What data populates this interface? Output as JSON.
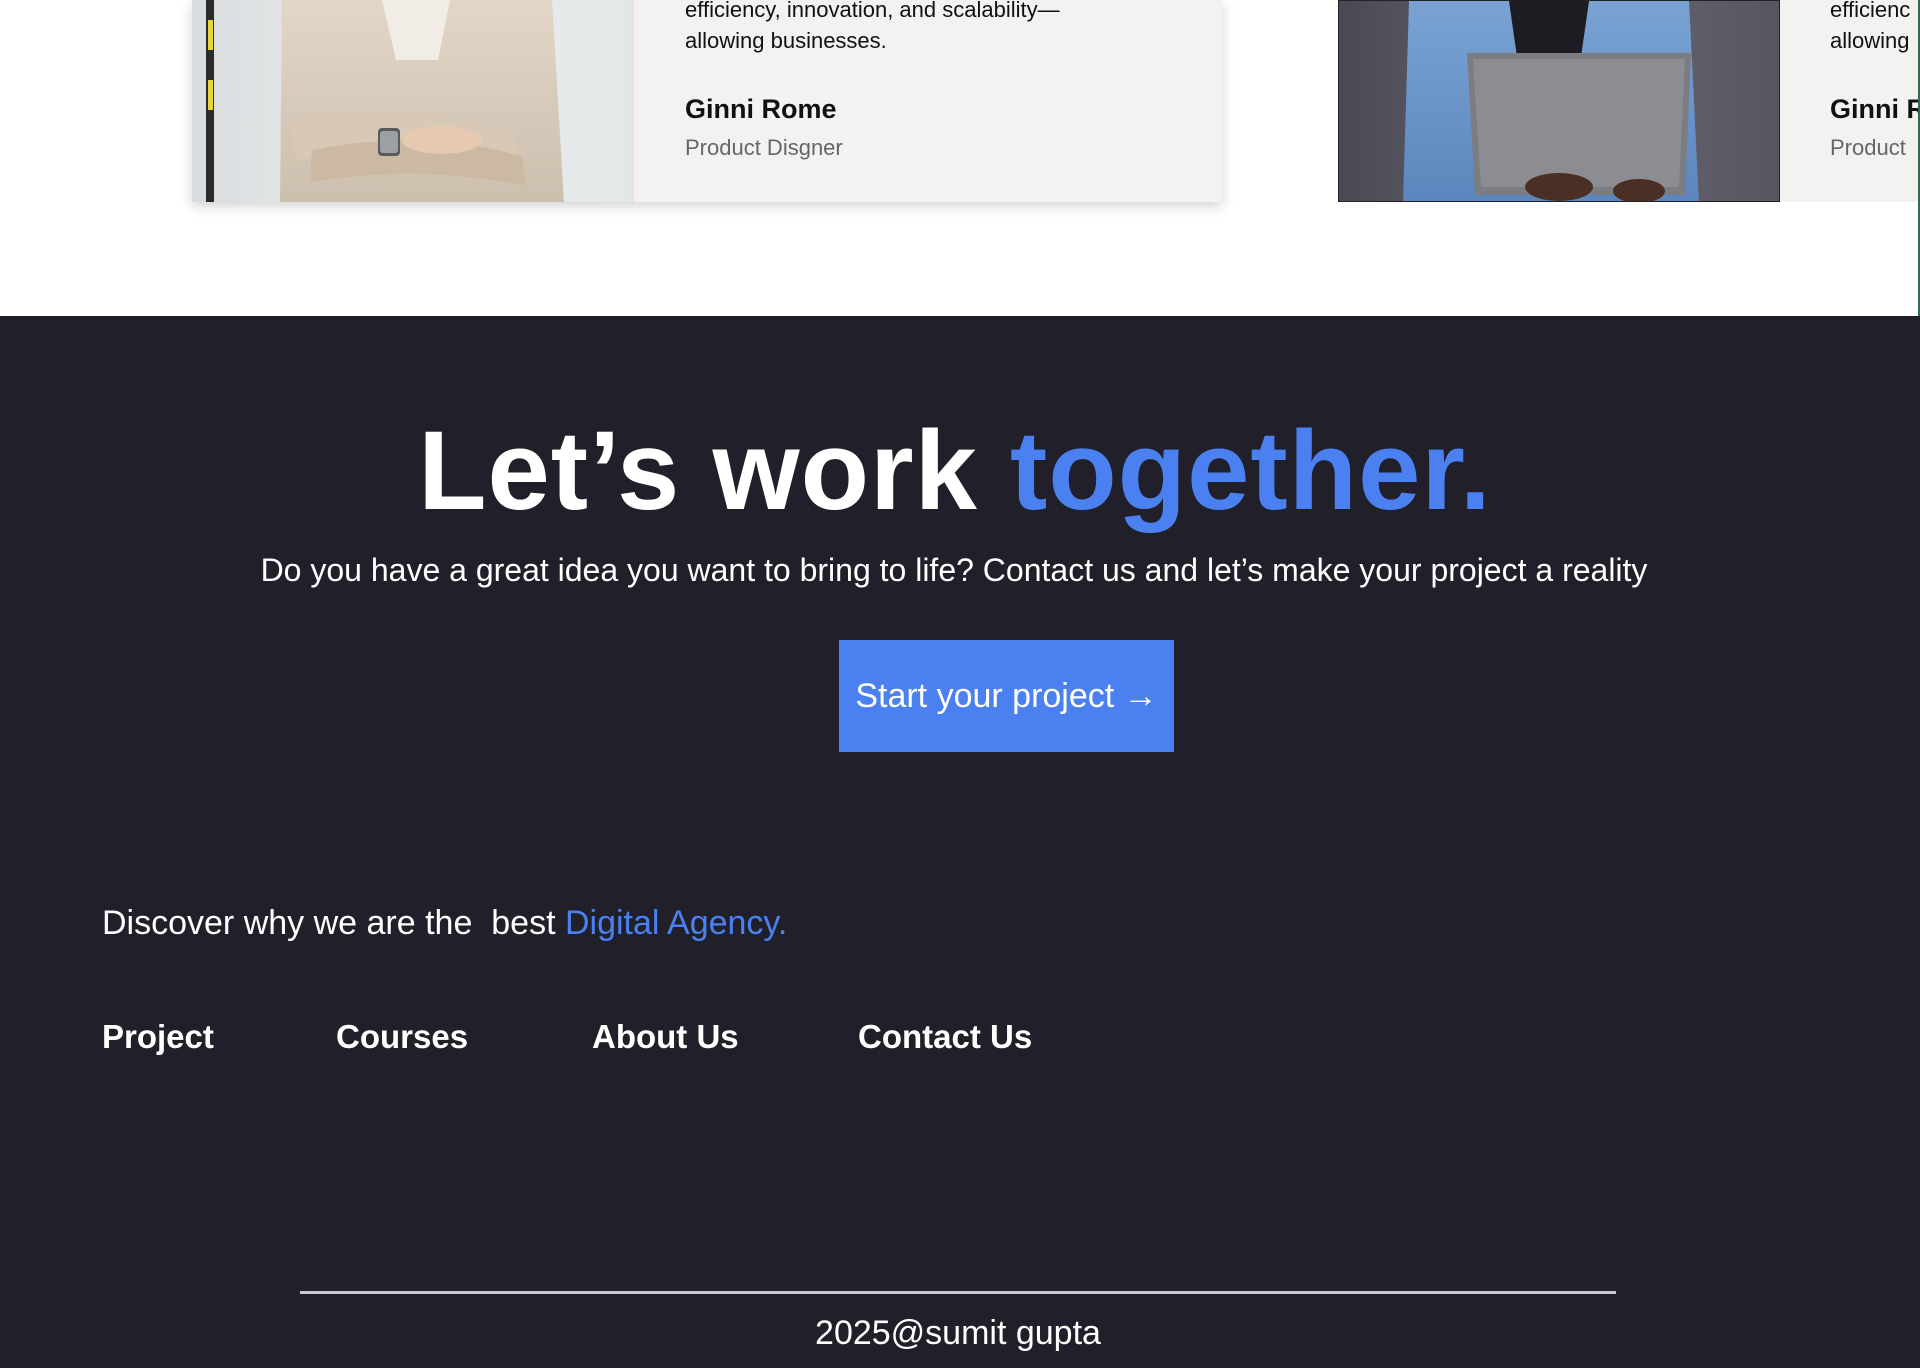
{
  "testimonials": [
    {
      "quote": "efficiency, innovation, and scalability—\nallowing businesses.",
      "name": "Ginni Rome",
      "role": "Product Disgner"
    },
    {
      "quote": "efficienc\nallowing",
      "name": "Ginni R",
      "role": "Product"
    }
  ],
  "cta": {
    "heading_main": "Let’s work ",
    "heading_accent": "together.",
    "subtitle": "Do you have a great idea you want to bring to life? Contact us and let’s make your project a reality",
    "button_label": "Start your project →"
  },
  "footer": {
    "discover_prefix": "Discover why we are the  best ",
    "discover_accent": "Digital Agency.",
    "nav": {
      "project": "Project",
      "courses": "Courses",
      "about": "About Us",
      "contact": "Contact Us"
    },
    "copyright": "2025@sumit gupta"
  },
  "colors": {
    "accent": "#4a80f0",
    "dark_background": "#21202a",
    "card_background": "#f3f2f0"
  }
}
